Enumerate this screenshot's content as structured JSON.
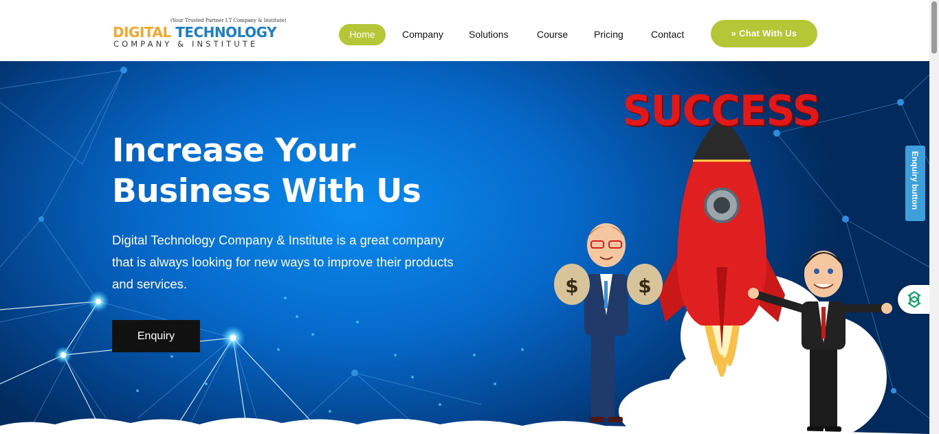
{
  "logo": {
    "tagline": "(Your Trusted Partner I.T Company & Institute)",
    "word1": "DIGITAL",
    "word2": "TECHNOLOGY",
    "line2": "COMPANY & INSTITUTE"
  },
  "nav": {
    "items": [
      {
        "label": "Home",
        "active": true
      },
      {
        "label": "Company"
      },
      {
        "label": "Solutions"
      },
      {
        "label": "Course"
      },
      {
        "label": "Pricing"
      },
      {
        "label": "Contact"
      }
    ],
    "chat_button": "Chat With Us"
  },
  "hero": {
    "title_line1": "Increase Your",
    "title_line2": "Business With Us",
    "description": "Digital Technology Company & Institute is a great company that is always looking for new ways to improve their products and services.",
    "enquiry_button": "Enquiry",
    "banner_word": "SUCCESS"
  },
  "side": {
    "enquiry_tab": "Enquiry button"
  },
  "colors": {
    "accent": "#b5c737",
    "hero_blue": "#0668c9",
    "side_tab": "#3ea0db"
  },
  "icons": [
    "double-chevron-icon",
    "ai-assistant-icon"
  ]
}
